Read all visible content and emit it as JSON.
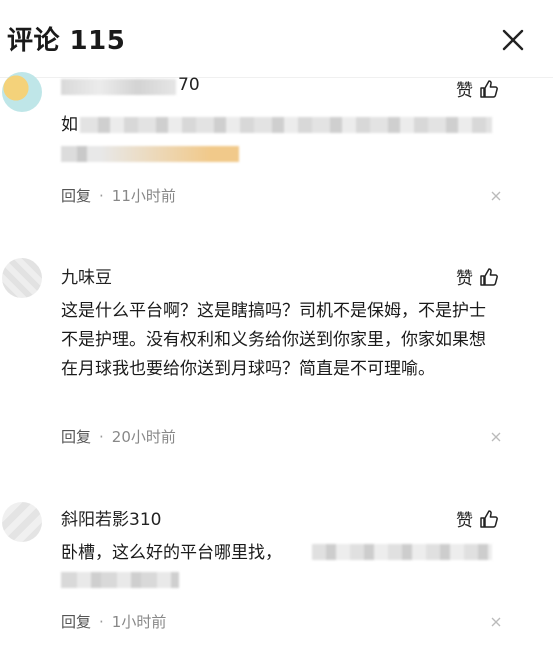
{
  "header": {
    "title": "评论 115"
  },
  "comments": [
    {
      "username_visible": "70",
      "like_label": "赞",
      "text_visible": "如",
      "reply_label": "回复",
      "separator": "·",
      "time": "11小时前"
    },
    {
      "username": "九味豆",
      "like_label": "赞",
      "text": "这是什么平台啊？这是瞎搞吗？司机不是保姆，不是护士不是护理。没有权利和义务给你送到你家里，你家如果想在月球我也要给你送到月球吗？简直是不可理喻。",
      "reply_label": "回复",
      "separator": "·",
      "time": "20小时前"
    },
    {
      "username": "斜阳若影310",
      "like_label": "赞",
      "text_visible": "卧槽，这么好的平台哪里找，   ",
      "reply_label": "回复",
      "separator": "·",
      "time": "1小时前"
    }
  ],
  "colors": {
    "background": "#ffffff",
    "text": "#1a1a1a",
    "meta": "#888888",
    "blur_gray": "#d6d6d6"
  }
}
